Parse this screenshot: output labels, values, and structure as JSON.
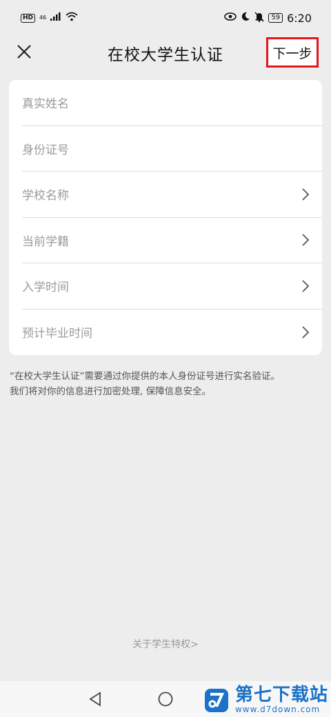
{
  "status_bar": {
    "hd": "HD",
    "network": "46",
    "battery": "59",
    "time": "6:20"
  },
  "nav": {
    "title": "在校大学生认证",
    "next_label": "下一步"
  },
  "form": {
    "rows": [
      {
        "label": "真实姓名"
      },
      {
        "label": "身份证号"
      },
      {
        "label": "学校名称"
      },
      {
        "label": "当前学籍"
      },
      {
        "label": "入学时间"
      },
      {
        "label": "预计毕业时间"
      }
    ]
  },
  "notice": {
    "line1": "“在校大学生认证”需要通过你提供的本人身份证号进行实名验证。",
    "line2": "我们将对你的信息进行加密处理, 保障信息安全。"
  },
  "footer": {
    "about_link": "关于学生特权>"
  },
  "watermark": {
    "name": "第七下载站",
    "url": "www.d7down.com"
  },
  "colors": {
    "highlight": "#e4141c",
    "background": "#ededed",
    "watermark": "#1a72c9"
  }
}
